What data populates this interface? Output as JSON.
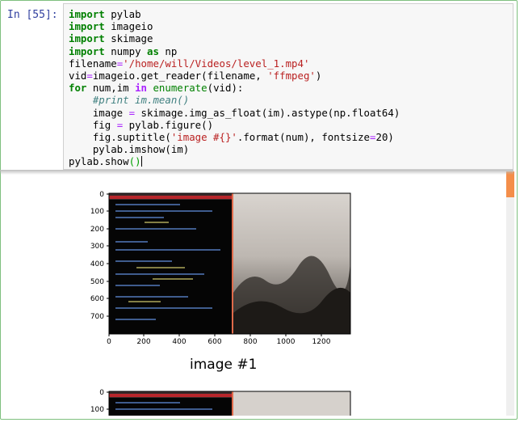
{
  "prompt": "In [55]:",
  "code_lines": [
    [
      "import pylab"
    ],
    [
      "import imageio"
    ],
    [
      "import skimage"
    ],
    [
      "import numpy as np"
    ],
    [
      "filename='/home/will/Videos/level_1.mp4'"
    ],
    [
      "vid=imageio.get_reader(filename, 'ffmpeg')"
    ],
    [
      "for num,im in enumerate(vid):"
    ],
    [
      "    #print im.mean()"
    ],
    [
      "    image = skimage.img_as_float(im).astype(np.float64)"
    ],
    [
      "    fig = pylab.figure()"
    ],
    [
      "    fig.suptitle('image #{}'.format(num), fontsize=20)"
    ],
    [
      "    pylab.imshow(im)"
    ],
    [
      "pylab.show()"
    ]
  ],
  "figure1": {
    "yticks": [
      "0",
      "100",
      "200",
      "300",
      "400",
      "500",
      "600",
      "700"
    ],
    "xticks": [
      "0",
      "200",
      "400",
      "600",
      "800",
      "1000",
      "1200"
    ]
  },
  "figure2": {
    "title": "image #1",
    "yticks": [
      "0",
      "100"
    ]
  },
  "colors": {
    "cell_border": "#7fc07f",
    "prompt": "#303f9f",
    "keyword": "#008000",
    "string": "#ba2121",
    "comment": "#408080",
    "scroll_thumb": "#f48e4a"
  }
}
